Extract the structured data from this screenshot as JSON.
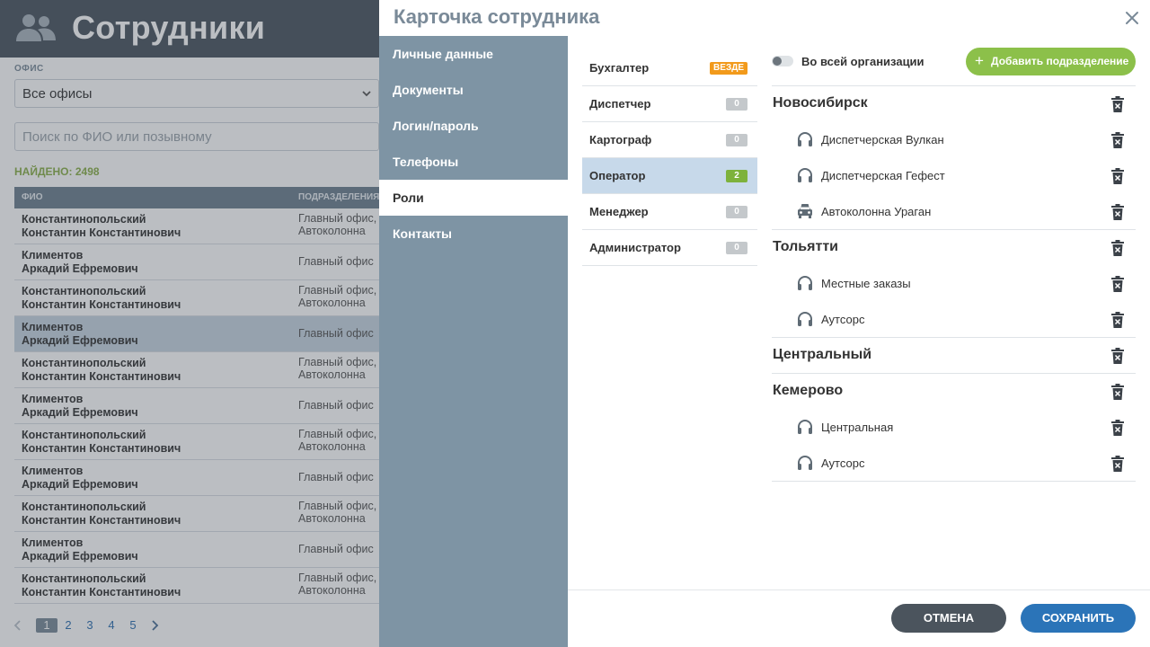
{
  "background": {
    "title": "Сотрудники",
    "office_label": "ОФИС",
    "office_value": "Все офисы",
    "search_placeholder": "Поиск по ФИО или позывному",
    "found": "НАЙДЕНО: 2498",
    "columns": [
      "ФИО",
      "ПОДРАЗДЕЛЕНИЯ"
    ],
    "rows": [
      {
        "name1": "Константинопольский",
        "name2": "Константин Константинович",
        "dep1": "Главный офис, Д",
        "dep2": "Автоколонна"
      },
      {
        "name1": "Климентов",
        "name2": "Аркадий Ефремович",
        "dep1": "Главный офис",
        "dep2": ""
      },
      {
        "name1": "Константинопольский",
        "name2": "Константин Константинович",
        "dep1": "Главный офис, Д",
        "dep2": "Автоколонна"
      },
      {
        "name1": "Климентов",
        "name2": "Аркадий Ефремович",
        "dep1": "Главный офис",
        "dep2": ""
      },
      {
        "name1": "Константинопольский",
        "name2": "Константин Константинович",
        "dep1": "Главный офис, Д",
        "dep2": "Автоколонна"
      },
      {
        "name1": "Климентов",
        "name2": "Аркадий Ефремович",
        "dep1": "Главный офис",
        "dep2": ""
      },
      {
        "name1": "Константинопольский",
        "name2": "Константин Константинович",
        "dep1": "Главный офис, Д",
        "dep2": "Автоколонна"
      },
      {
        "name1": "Климентов",
        "name2": "Аркадий Ефремович",
        "dep1": "Главный офис",
        "dep2": ""
      },
      {
        "name1": "Константинопольский",
        "name2": "Константин Константинович",
        "dep1": "Главный офис, Д",
        "dep2": "Автоколонна"
      },
      {
        "name1": "Климентов",
        "name2": "Аркадий Ефремович",
        "dep1": "Главный офис",
        "dep2": ""
      },
      {
        "name1": "Константинопольский",
        "name2": "Константин Константинович",
        "dep1": "Главный офис, Д",
        "dep2": "Автоколонна"
      }
    ],
    "selected_row": 3,
    "pages": [
      "1",
      "2",
      "3",
      "4",
      "5"
    ],
    "current_page": "1"
  },
  "modal": {
    "title": "Карточка сотрудника",
    "nav": [
      "Личные данные",
      "Документы",
      "Логин/пароль",
      "Телефоны",
      "Роли",
      "Контакты"
    ],
    "active_nav": "Роли",
    "roles": [
      {
        "label": "Бухгалтер",
        "badge": "ВЕЗДЕ",
        "badge_color": "#f29a1b"
      },
      {
        "label": "Диспетчер",
        "badge": "0",
        "badge_color": "#c4c8cb"
      },
      {
        "label": "Картограф",
        "badge": "0",
        "badge_color": "#c4c8cb"
      },
      {
        "label": "Оператор",
        "badge": "2",
        "badge_color": "#7eb23c"
      },
      {
        "label": "Менеджер",
        "badge": "0",
        "badge_color": "#c4c8cb"
      },
      {
        "label": "Администратор",
        "badge": "0",
        "badge_color": "#c4c8cb"
      }
    ],
    "active_role": "Оператор",
    "toggle_label": "Во всей организации",
    "toggle_on": false,
    "add_button": "Добавить подразделение",
    "groups": [
      {
        "name": "Новосибирск",
        "items": [
          {
            "label": "Диспетчерская Вулкан",
            "icon": "headset-icon"
          },
          {
            "label": "Диспетчерская Гефест",
            "icon": "headset-icon"
          },
          {
            "label": "Автоколонна Ураган",
            "icon": "taxi-icon"
          }
        ]
      },
      {
        "name": "Тольятти",
        "items": [
          {
            "label": "Местные заказы",
            "icon": "headset-icon"
          },
          {
            "label": "Аутсорс",
            "icon": "headset-icon"
          }
        ]
      },
      {
        "name": "Центральный",
        "items": []
      },
      {
        "name": "Кемерово",
        "items": [
          {
            "label": "Центральная",
            "icon": "headset-icon"
          },
          {
            "label": "Аутсорс",
            "icon": "headset-icon"
          }
        ]
      }
    ],
    "cancel": "ОТМЕНА",
    "save": "СОХРАНИТЬ"
  }
}
